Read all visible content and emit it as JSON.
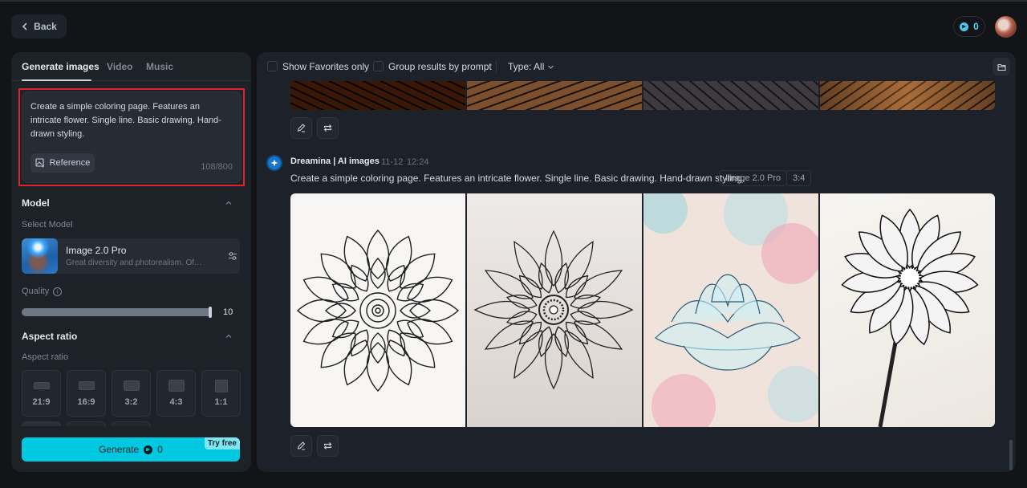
{
  "nav": {
    "back_label": "Back",
    "credits": "0",
    "credits_icon": "credit-coin-icon",
    "avatar_icon": "user-avatar"
  },
  "left_panel": {
    "tabs": [
      {
        "label": "Generate images",
        "active": true
      },
      {
        "label": "Video",
        "active": false
      },
      {
        "label": "Music",
        "active": false
      }
    ],
    "prompt": {
      "value": "Create a simple coloring page. Features an intricate flower. Single line. Basic drawing. Hand-drawn styling.",
      "reference_label": "Reference",
      "char_count": "108/800",
      "highlight_color": "#e0232b"
    },
    "model_section": {
      "title": "Model",
      "select_label": "Select Model",
      "model_name": "Image 2.0 Pro",
      "model_desc": "Great diversity and photorealism. Offers..."
    },
    "quality": {
      "label": "Quality",
      "value": "10",
      "fraction": 1.0
    },
    "aspect_section": {
      "title": "Aspect ratio",
      "sub_label": "Aspect ratio",
      "options": [
        {
          "label": "21:9"
        },
        {
          "label": "16:9"
        },
        {
          "label": "3:2"
        },
        {
          "label": "4:3"
        },
        {
          "label": "1:1"
        }
      ]
    },
    "generate": {
      "label": "Generate",
      "cost": "0",
      "badge": "Try free",
      "color": "#00c8e0"
    }
  },
  "main_panel": {
    "filters": {
      "favorites_label": "Show Favorites only",
      "group_label": "Group results by prompt",
      "type_label": "Type: All"
    },
    "previous_generation": {
      "images": [
        "cracked-earth-1",
        "cracked-earth-2",
        "cracked-earth-3",
        "cracked-earth-4"
      ]
    },
    "generation": {
      "author": "Dreamina | AI images",
      "date": "11-12",
      "time": "12:24",
      "prompt": "Create a simple coloring page. Features an intricate flower. Single line. Basic drawing. Hand-drawn styling.",
      "model_tag": "Image 2.0 Pro",
      "ratio_tag": "3:4",
      "images": [
        {
          "name": "mandala-flower-line-art"
        },
        {
          "name": "star-mandala-flower"
        },
        {
          "name": "colored-lotus-pattern"
        },
        {
          "name": "single-daisy-with-stem"
        }
      ]
    }
  }
}
